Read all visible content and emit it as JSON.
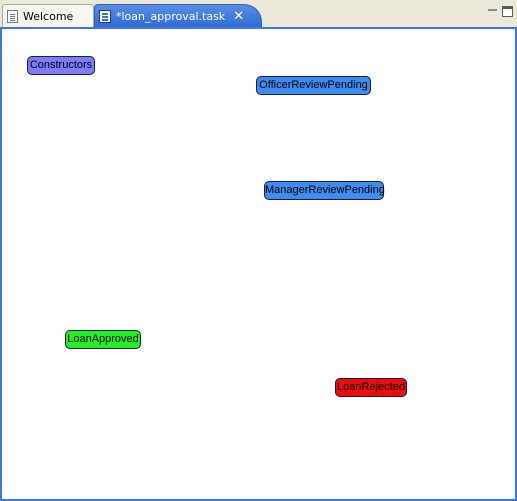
{
  "tabs": [
    {
      "label": "Welcome",
      "icon": "document-icon"
    },
    {
      "label": "*loan_approval.task",
      "icon": "task-file-icon",
      "active": true
    }
  ],
  "colors": {
    "tab_active": "#3a72dc",
    "canvas_border": "#3f78d8"
  },
  "nodes": {
    "constructors": {
      "label": "Constructors",
      "color": "#7c7cff"
    },
    "officer": {
      "label": "OfficerReviewPending",
      "color": "#3f8cf0"
    },
    "manager": {
      "label": "ManagerReviewPending",
      "color": "#3f8cf0"
    },
    "approved": {
      "label": "LoanApproved",
      "color": "#22f022"
    },
    "rejected": {
      "label": "LoanRejected",
      "color": "#ee0b0b"
    }
  }
}
